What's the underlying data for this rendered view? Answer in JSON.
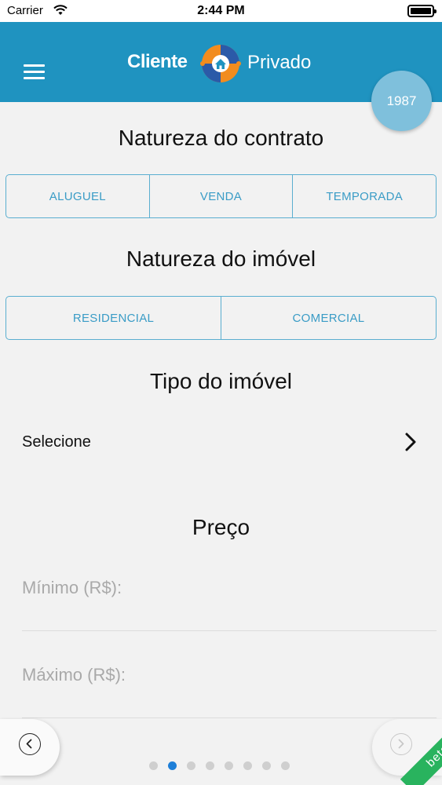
{
  "status_bar": {
    "carrier": "Carrier",
    "time": "2:44 PM"
  },
  "header": {
    "logo_left": "Cliente",
    "logo_right": "Privado",
    "badge": "1987"
  },
  "sections": {
    "contract": {
      "title": "Natureza do contrato",
      "options": [
        "ALUGUEL",
        "VENDA",
        "TEMPORADA"
      ]
    },
    "property": {
      "title": "Natureza do imóvel",
      "options": [
        "RESIDENCIAL",
        "COMERCIAL"
      ]
    },
    "type": {
      "title": "Tipo do imóvel",
      "select_label": "Selecione"
    },
    "price": {
      "title": "Preço",
      "min_placeholder": "Mínimo (R$):",
      "max_placeholder": "Máximo (R$):"
    }
  },
  "pager": {
    "total": 8,
    "active": 2
  },
  "beta_label": "beta",
  "colors": {
    "header": "#1f93c0",
    "accent": "#3a9cc6",
    "badge": "#7fc0dc",
    "beta": "#29b35e",
    "active_dot": "#1e7fd8"
  }
}
